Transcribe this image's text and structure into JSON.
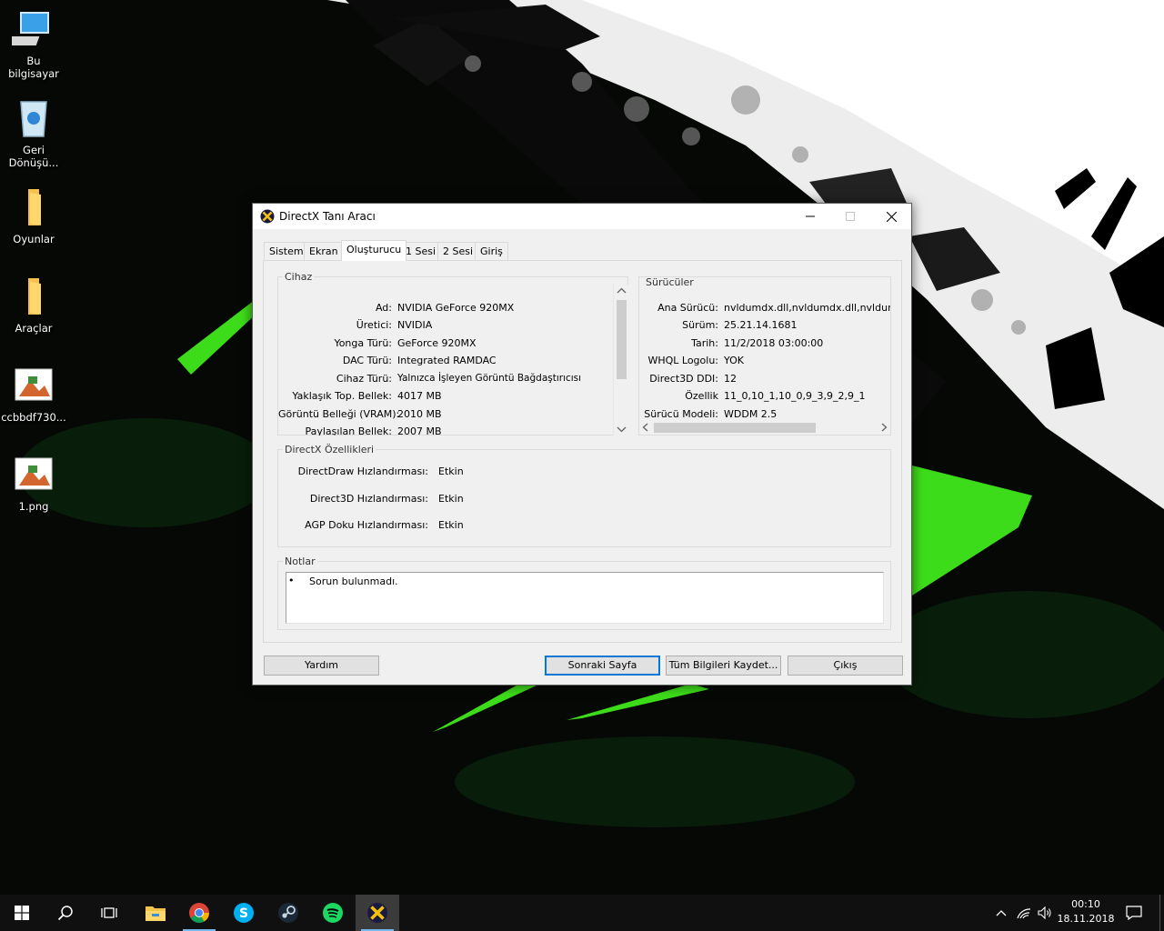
{
  "desktop": {
    "icons": [
      {
        "label": "Bu bilgisayar",
        "icon": "this-pc-icon"
      },
      {
        "label": "Geri\nDönüşü...",
        "icon": "recycle-bin-icon"
      },
      {
        "label": "Oyunlar",
        "icon": "folder-icon"
      },
      {
        "label": "Araçlar",
        "icon": "folder-icon"
      },
      {
        "label": "ccbbdf730...",
        "icon": "image-file-icon"
      },
      {
        "label": "1.png",
        "icon": "image-file-icon"
      }
    ]
  },
  "window": {
    "title": "DirectX Tanı Aracı",
    "tabs": [
      "Sistem",
      "Ekran",
      "Oluşturucu",
      "1 Sesi",
      "2 Sesi",
      "Giriş"
    ],
    "active_tab": "Oluşturucu",
    "device": {
      "title": "Cihaz",
      "rows": [
        {
          "k": "Ad:",
          "v": "NVIDIA GeForce 920MX"
        },
        {
          "k": "Üretici:",
          "v": "NVIDIA"
        },
        {
          "k": "Yonga Türü:",
          "v": "GeForce 920MX"
        },
        {
          "k": "DAC Türü:",
          "v": "Integrated RAMDAC"
        },
        {
          "k": "Cihaz Türü:",
          "v": "Yalnızca İşleyen Görüntü Bağdaştırıcısı"
        },
        {
          "k": "Yaklaşık Top. Bellek:",
          "v": "4017 MB"
        },
        {
          "k": "Görüntü Belleği (VRAM):",
          "v": "2010 MB"
        },
        {
          "k": "Paylaşılan Bellek:",
          "v": "2007 MB"
        }
      ]
    },
    "drivers": {
      "title": "Sürücüler",
      "rows": [
        {
          "k": "Ana Sürücü:",
          "v": "nvldumdx.dll,nvldumdx.dll,nvldumdx.d"
        },
        {
          "k": "Sürüm:",
          "v": "25.21.14.1681"
        },
        {
          "k": "Tarih:",
          "v": "11/2/2018 03:00:00"
        },
        {
          "k": "WHQL Logolu:",
          "v": "YOK"
        },
        {
          "k": "Direct3D DDI:",
          "v": "12"
        },
        {
          "k": "Özellik",
          "v": "11_0,10_1,10_0,9_3,9_2,9_1"
        },
        {
          "k": "Sürücü Modeli:",
          "v": "WDDM 2.5"
        }
      ]
    },
    "features": {
      "title": "DirectX Özellikleri",
      "rows": [
        {
          "k": "DirectDraw Hızlandırması:",
          "v": "Etkin"
        },
        {
          "k": "Direct3D Hızlandırması:",
          "v": "Etkin"
        },
        {
          "k": "AGP Doku Hızlandırması:",
          "v": "Etkin"
        }
      ]
    },
    "notes": {
      "title": "Notlar",
      "items": [
        "Sorun bulunmadı."
      ]
    },
    "buttons": {
      "help": "Yardım",
      "next": "Sonraki Sayfa",
      "save_all": "Tüm Bilgileri Kaydet...",
      "exit": "Çıkış"
    }
  },
  "taskbar": {
    "apps": [
      "file-explorer",
      "chrome",
      "skype",
      "steam",
      "spotify",
      "directx-diagnostic"
    ],
    "clock": {
      "time": "00:10",
      "date": "18.11.2018"
    }
  },
  "colors": {
    "accent": "#0078d7",
    "wallpaper_green": "#3ddc1a",
    "taskbar": "#101010"
  }
}
